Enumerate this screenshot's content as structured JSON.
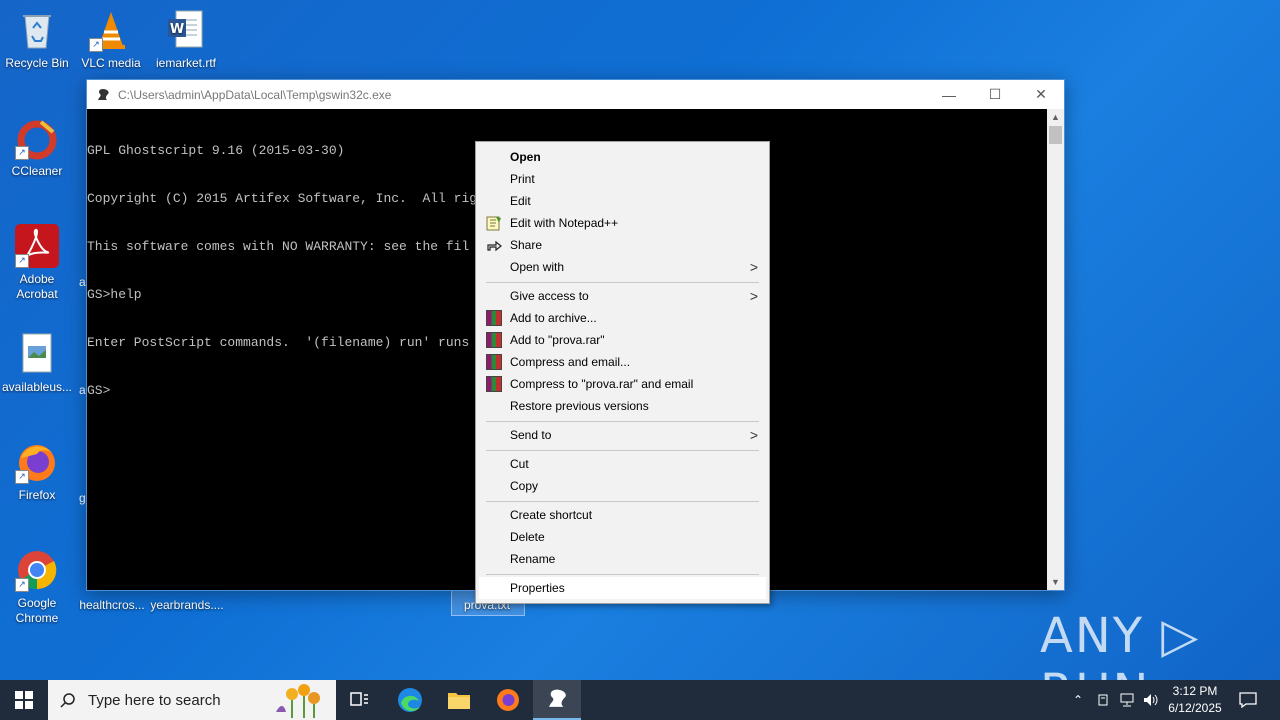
{
  "desktop": {
    "icons": [
      {
        "label": "Recycle Bin"
      },
      {
        "label": "VLC media"
      },
      {
        "label": "iemarket.rtf"
      },
      {
        "label": "CCleaner"
      },
      {
        "label": "Adobe Acrobat"
      },
      {
        "label": "availableus..."
      },
      {
        "label": "Firefox"
      },
      {
        "label": "Google Chrome"
      },
      {
        "label": "healthcros..."
      },
      {
        "label": "yearbrands...."
      },
      {
        "label": "prova.txt"
      }
    ],
    "partial_letters": [
      "a",
      "a",
      "g"
    ]
  },
  "console": {
    "title": "C:\\Users\\admin\\AppData\\Local\\Temp\\gswin32c.exe",
    "lines": [
      "GPL Ghostscript 9.16 (2015-03-30)",
      "Copyright (C) 2015 Artifex Software, Inc.  All rights reserved.",
      "This software comes with NO WARRANTY: see the fil",
      "GS>help",
      "Enter PostScript commands.  '(filename) run' runs",
      "GS>"
    ],
    "minimize": "—",
    "maximize": "☐",
    "close": "✕"
  },
  "context_menu": {
    "items": [
      {
        "label": "Open"
      },
      {
        "label": "Print"
      },
      {
        "label": "Edit"
      },
      {
        "label": "Edit with Notepad++"
      },
      {
        "label": "Share"
      },
      {
        "label": "Open with"
      },
      {
        "label": "Give access to"
      },
      {
        "label": "Add to archive..."
      },
      {
        "label": "Add to \"prova.rar\""
      },
      {
        "label": "Compress and email..."
      },
      {
        "label": "Compress to \"prova.rar\" and email"
      },
      {
        "label": "Restore previous versions"
      },
      {
        "label": "Send to"
      },
      {
        "label": "Cut"
      },
      {
        "label": "Copy"
      },
      {
        "label": "Create shortcut"
      },
      {
        "label": "Delete"
      },
      {
        "label": "Rename"
      },
      {
        "label": "Properties"
      }
    ]
  },
  "taskbar": {
    "search_placeholder": "Type here to search",
    "time": "3:12 PM",
    "date": "6/12/2025"
  },
  "watermark": "ANY ▷ RUN"
}
